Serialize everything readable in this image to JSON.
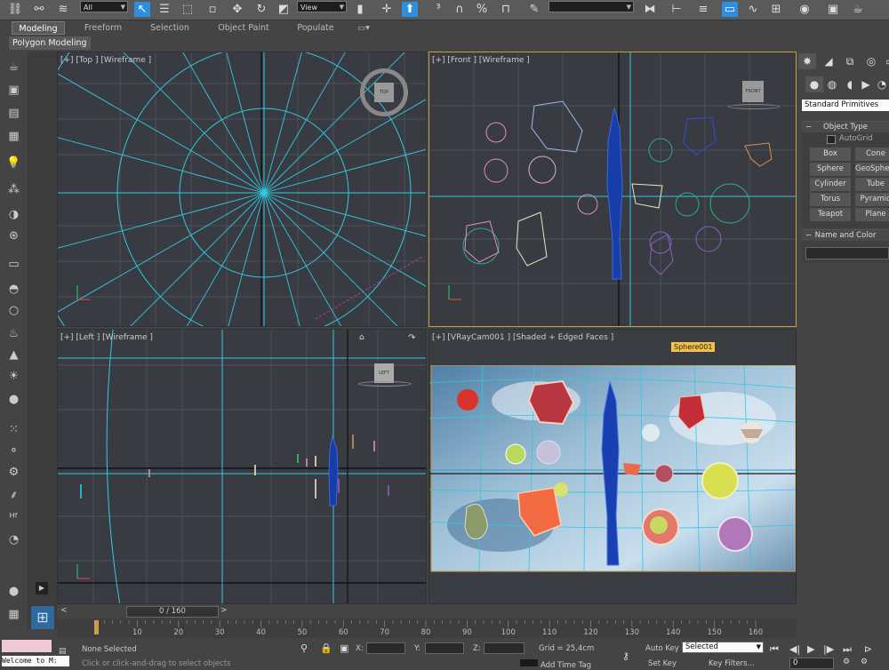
{
  "toolbar": {
    "selection_filter": "All",
    "ref_coord": "View",
    "icons": [
      "link-icon",
      "unlink-icon",
      "bind-spacewarp-icon",
      "select-object-icon",
      "select-by-name-icon",
      "rect-selection-icon",
      "window-crossing-icon",
      "move-icon",
      "rotate-icon",
      "scale-icon",
      "use-pivot-icon",
      "select-manipulate-icon",
      "keyboard-shortcut-icon",
      "snap-toggle-icon",
      "angle-snap-icon",
      "percent-snap-icon",
      "spinner-snap-icon",
      "edit-named-sel-icon",
      "mirror-icon",
      "align-icon",
      "layer-icon",
      "curve-editor-icon",
      "schematic-icon",
      "material-editor-icon",
      "render-setup-icon",
      "render-frame-icon",
      "render-icon"
    ]
  },
  "ribbon": {
    "tabs": [
      "Modeling",
      "Freeform",
      "Selection",
      "Object Paint",
      "Populate"
    ],
    "active_tab": "Modeling",
    "panel_label": "Polygon Modeling"
  },
  "viewports": {
    "top": {
      "label": "[+] [Top ] [Wireframe ]",
      "viewcube": "TOP"
    },
    "front": {
      "label": "[+] [Front ] [Wireframe ]",
      "viewcube": "FRONT"
    },
    "left": {
      "label": "[+] [Left ] [Wireframe ]",
      "viewcube": "LEFT"
    },
    "camera": {
      "label": "[+] [VRayCam001 ] [Shaded + Edged Faces ]",
      "tooltip": "Sphere001"
    }
  },
  "command_panel": {
    "category_dropdown": "Standard Primitives",
    "object_type_header": "Object Type",
    "autogrid_label": "AutoGrid",
    "buttons": [
      [
        "Box",
        "Cone"
      ],
      [
        "Sphere",
        "GeoSphere"
      ],
      [
        "Cylinder",
        "Tube"
      ],
      [
        "Torus",
        "Pyramid"
      ],
      [
        "Teapot",
        "Plane"
      ]
    ],
    "name_color_header": "Name and Color"
  },
  "timeline": {
    "slider_label": "0 / 160",
    "ticks": [
      "10",
      "20",
      "30",
      "40",
      "50",
      "60",
      "70",
      "80",
      "90",
      "100",
      "110",
      "120",
      "130",
      "140",
      "150",
      "160"
    ]
  },
  "status": {
    "maxscript": "Welcome to M:",
    "selection": "None Selected",
    "prompt": "Click or click-and-drag to select objects",
    "x_label": "X:",
    "y_label": "Y:",
    "z_label": "Z:",
    "grid": "Grid = 25,4cm",
    "add_time_tag": "Add Time Tag",
    "auto_key": "Auto Key",
    "set_key": "Set Key",
    "key_mode": "Selected",
    "key_filters": "Key Filters...",
    "frame": "0"
  },
  "colors": {
    "accent": "#2e8ee0",
    "active_border": "#c8a040",
    "grid_line": "#33c8e0",
    "tooltip_bg": "#f2c14a"
  }
}
